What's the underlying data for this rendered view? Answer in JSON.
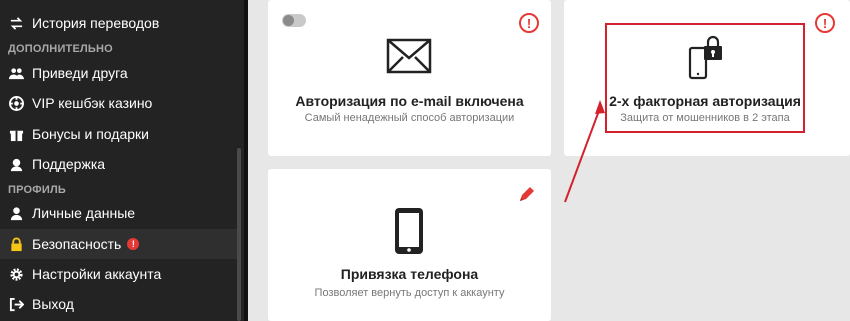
{
  "sidebar": {
    "items_top": [
      {
        "label": "История переводов",
        "icon": "transfer-icon"
      }
    ],
    "section_extra": "ДОПОЛНИТЕЛЬНО",
    "items_extra": [
      {
        "label": "Приведи друга",
        "icon": "users-icon"
      },
      {
        "label": "VIP кешбэк казино",
        "icon": "casino-chip-icon"
      },
      {
        "label": "Бонусы и подарки",
        "icon": "gift-icon"
      },
      {
        "label": "Поддержка",
        "icon": "support-icon"
      }
    ],
    "section_profile": "ПРОФИЛЬ",
    "items_profile": [
      {
        "label": "Личные данные",
        "icon": "user-icon"
      },
      {
        "label": "Безопасность",
        "icon": "lock-icon",
        "active": true,
        "alert": "!"
      },
      {
        "label": "Настройки аккаунта",
        "icon": "gear-icon"
      },
      {
        "label": "Выход",
        "icon": "logout-icon"
      }
    ]
  },
  "cards": {
    "email": {
      "title": "Авторизация по e-mail включена",
      "subtitle": "Самый ненадежный способ авторизации",
      "warning": "!"
    },
    "twofa": {
      "title": "2-х факторная авторизация",
      "subtitle": "Защита от мошенников в 2 этапа",
      "warning": "!"
    },
    "phone": {
      "title": "Привязка телефона",
      "subtitle": "Позволяет вернуть доступ к аккаунту"
    }
  },
  "colors": {
    "accent_yellow": "#f5c518",
    "alert_red": "#e53935",
    "annotation_red": "#d3212d"
  }
}
